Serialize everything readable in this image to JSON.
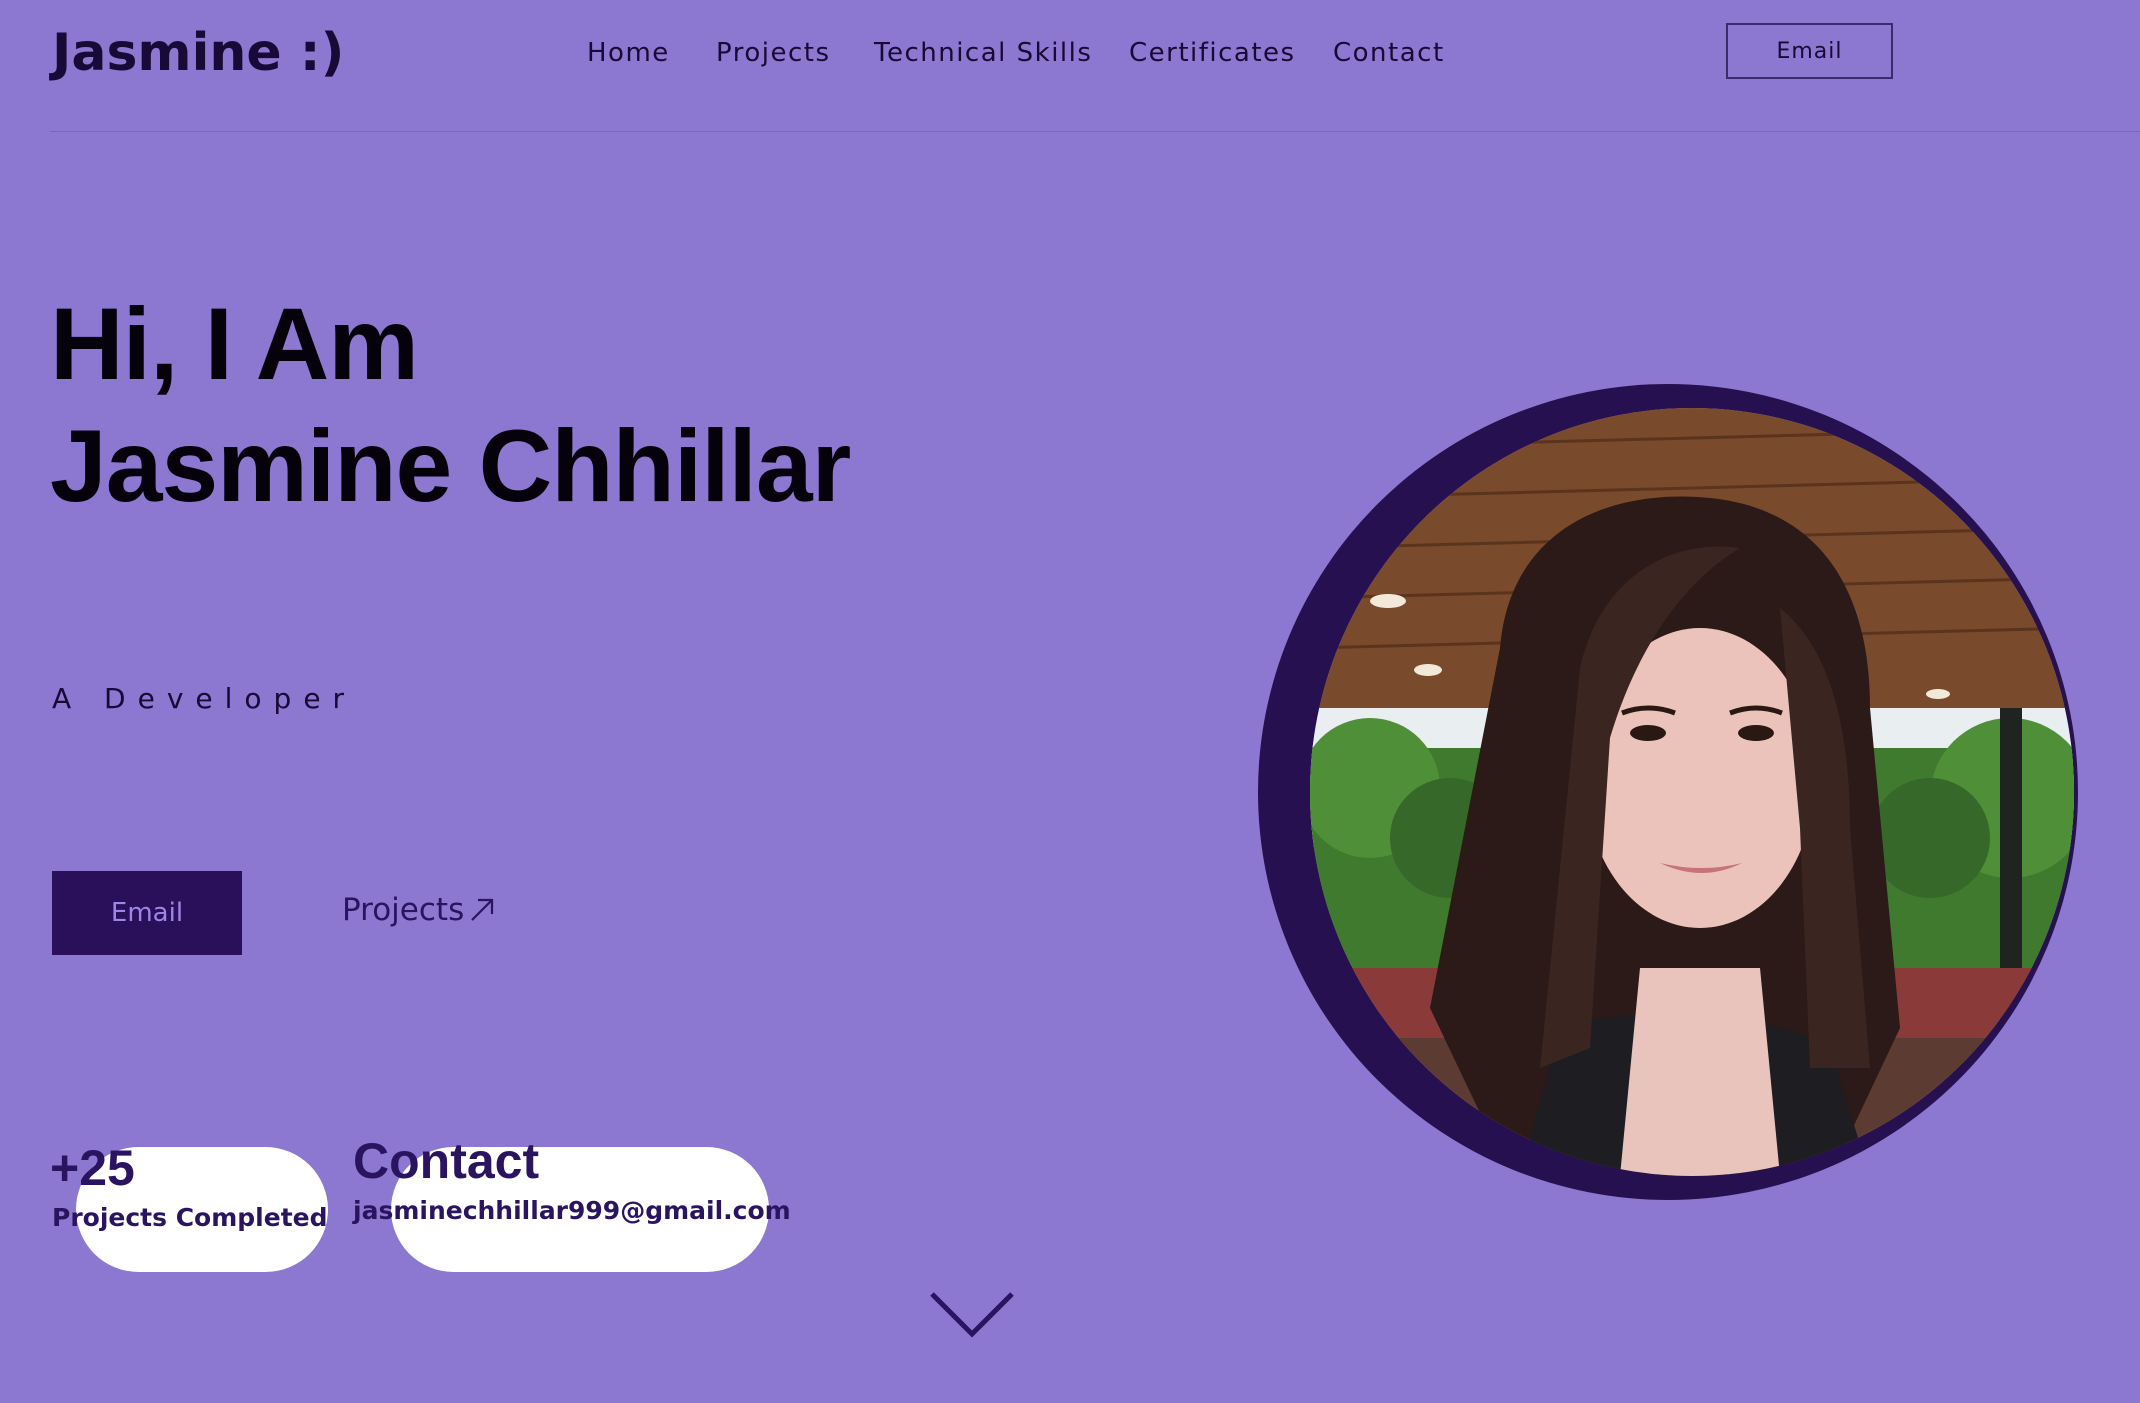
{
  "header": {
    "brand": "Jasmine :)",
    "nav": [
      {
        "label": "Home"
      },
      {
        "label": "Projects"
      },
      {
        "label": "Technical Skills"
      },
      {
        "label": "Certificates"
      },
      {
        "label": "Contact"
      }
    ],
    "email_button": "Email"
  },
  "hero": {
    "greeting": "Hi, I Am",
    "name": "Jasmine Chhillar",
    "role": "A Developer",
    "email_button": "Email",
    "projects_link": "Projects"
  },
  "stats": {
    "projects_count": "+25",
    "projects_label": "Projects Completed",
    "contact_title": "Contact",
    "contact_email": "jasminechhillar999@gmail.com"
  },
  "icons": {
    "projects_arrow": "arrow-up-right-icon",
    "scroll": "chevron-down-icon"
  },
  "colors": {
    "background": "#8c77d1",
    "accent_dark": "#2a0f5a",
    "ring": "#26104f",
    "text_dark": "#180a36"
  }
}
